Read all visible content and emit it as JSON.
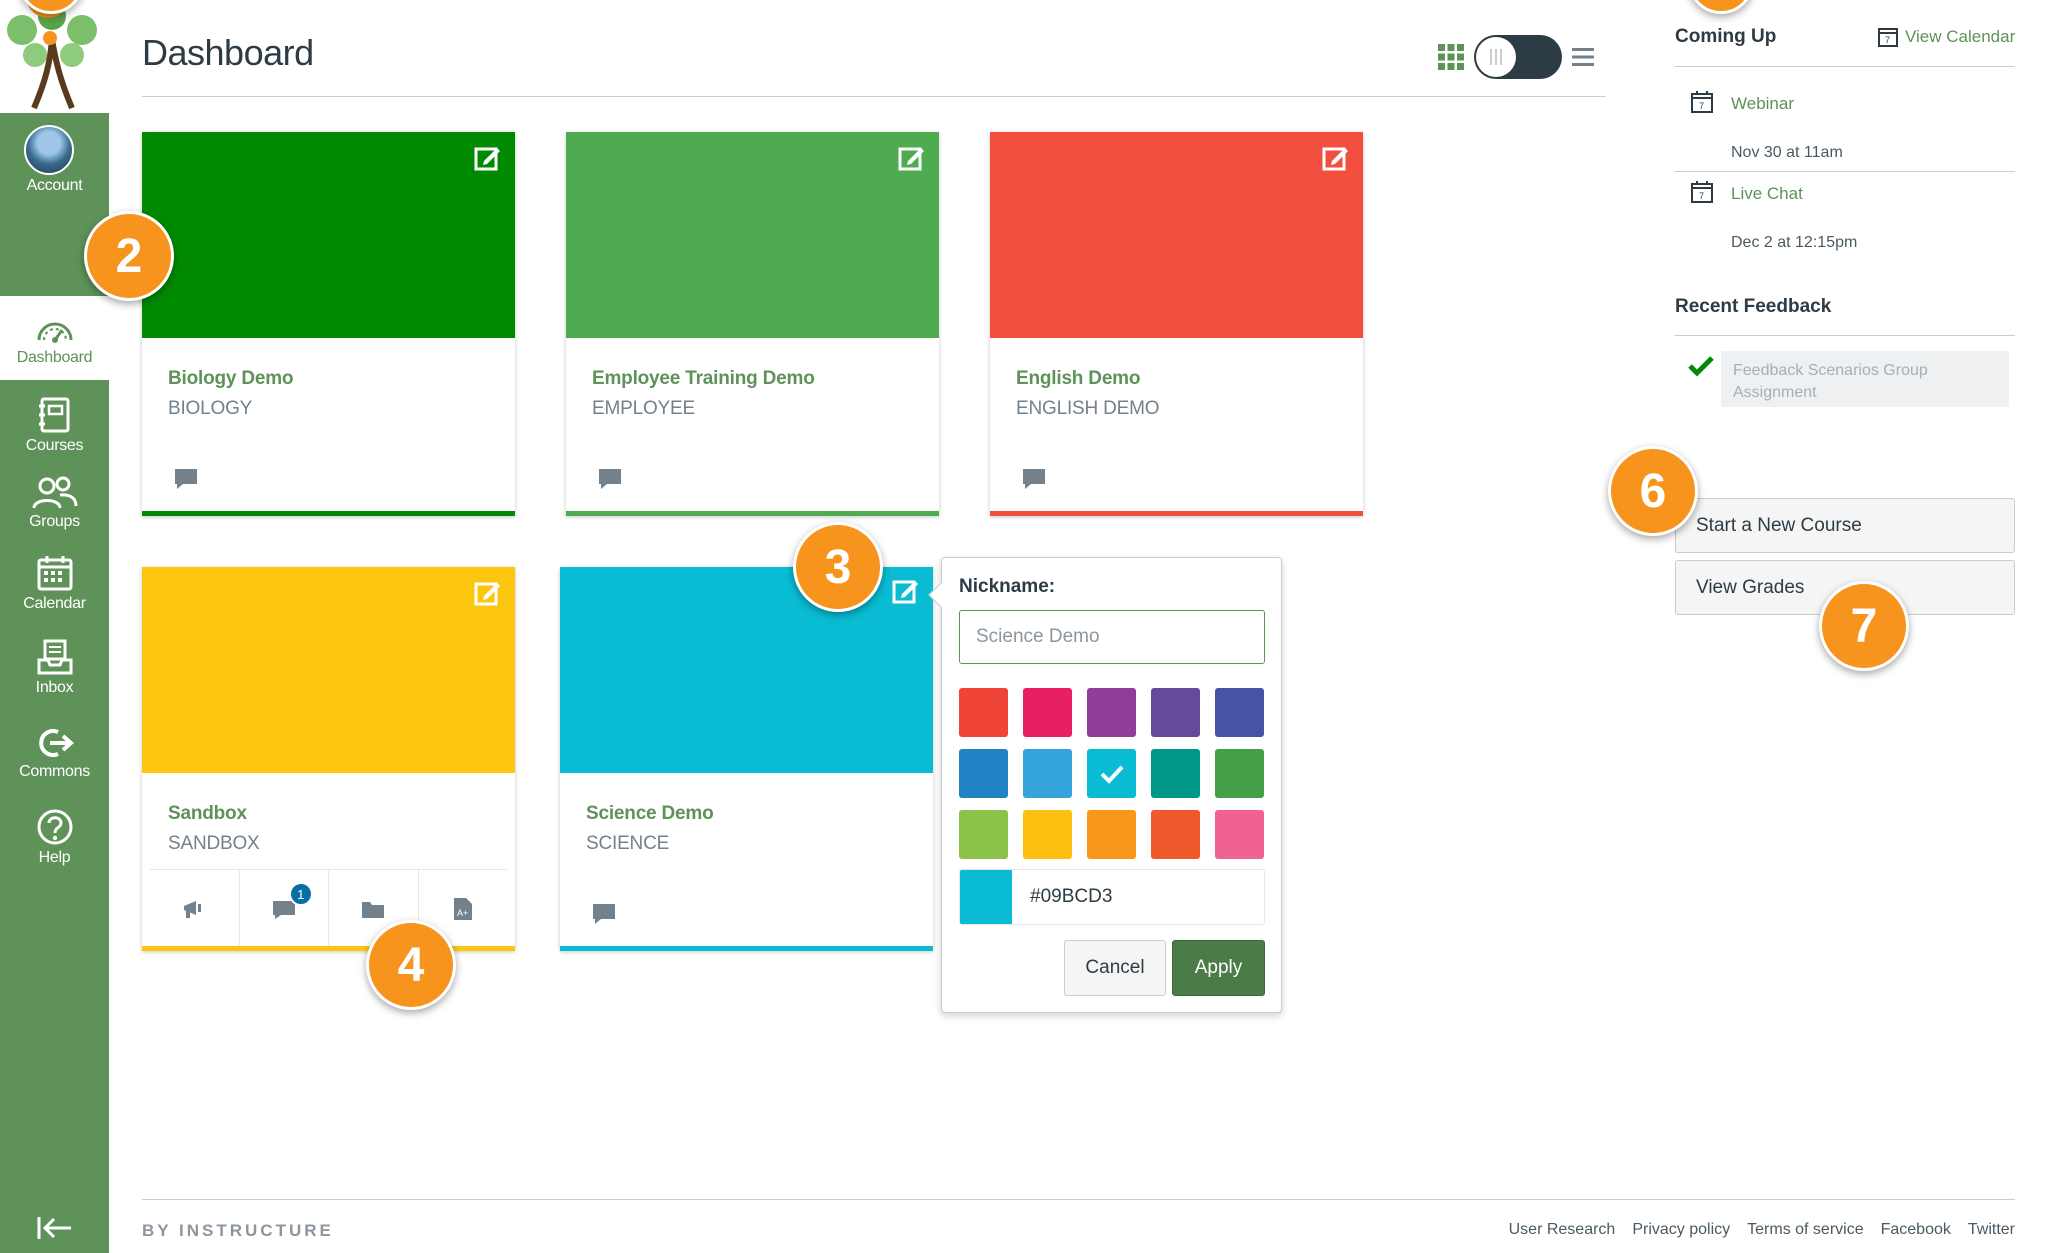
{
  "nav": {
    "account_label": "Account",
    "items": [
      {
        "label": "Dashboard",
        "icon": "dashboard-icon"
      },
      {
        "label": "Courses",
        "icon": "courses-icon"
      },
      {
        "label": "Groups",
        "icon": "groups-icon"
      },
      {
        "label": "Calendar",
        "icon": "calendar-icon"
      },
      {
        "label": "Inbox",
        "icon": "inbox-icon"
      },
      {
        "label": "Commons",
        "icon": "commons-icon"
      },
      {
        "label": "Help",
        "icon": "help-icon"
      }
    ],
    "collapse_icon": "collapse-nav-icon"
  },
  "header": {
    "title": "Dashboard"
  },
  "cards": [
    {
      "name": "Biology Demo",
      "code": "BIOLOGY",
      "color": "#008a00"
    },
    {
      "name": "Employee Training Demo",
      "code": "EMPLOYEE",
      "color": "#4fab4f"
    },
    {
      "name": "English Demo",
      "code": "ENGLISH DEMO",
      "color": "#f24f41"
    },
    {
      "name": "Sandbox",
      "code": "SANDBOX",
      "color": "#fcc60f",
      "unread_discussions": "1"
    },
    {
      "name": "Science Demo",
      "code": "SCIENCE",
      "color": "#09bcd3"
    }
  ],
  "popover": {
    "label": "Nickname:",
    "placeholder": "Science Demo",
    "swatches": [
      "#ef4437",
      "#e71f63",
      "#8f3e97",
      "#65499d",
      "#4554a4",
      "#2083c5",
      "#35a4dc",
      "#09bcd3",
      "#009688",
      "#43a047",
      "#8bc34a",
      "#fdc010",
      "#f8971c",
      "#f0592b",
      "#f06291"
    ],
    "selected_swatch": "#09bcd3",
    "hex_value": "#09BCD3",
    "cancel_label": "Cancel",
    "apply_label": "Apply"
  },
  "sidebar": {
    "coming_up_title": "Coming Up",
    "view_calendar_label": "View Calendar",
    "events": [
      {
        "title": "Webinar",
        "date": "Nov 30 at 11am"
      },
      {
        "title": "Live Chat",
        "date": "Dec 2 at 12:15pm"
      }
    ],
    "recent_feedback_title": "Recent Feedback",
    "feedback_item": "Feedback Scenarios Group Assignment",
    "start_course_label": "Start a New Course",
    "view_grades_label": "View Grades"
  },
  "footer": {
    "brand": "BY INSTRUCTURE",
    "links": [
      "User Research",
      "Privacy policy",
      "Terms of service",
      "Facebook",
      "Twitter"
    ]
  },
  "callouts": {
    "c2": "2",
    "c3": "3",
    "c4": "4",
    "c6": "6",
    "c7": "7"
  },
  "colors": {
    "nav_bg": "#5e9259",
    "accent": "#5e9259",
    "apply_bg": "#4b7b47",
    "callout": "#f7941d"
  }
}
